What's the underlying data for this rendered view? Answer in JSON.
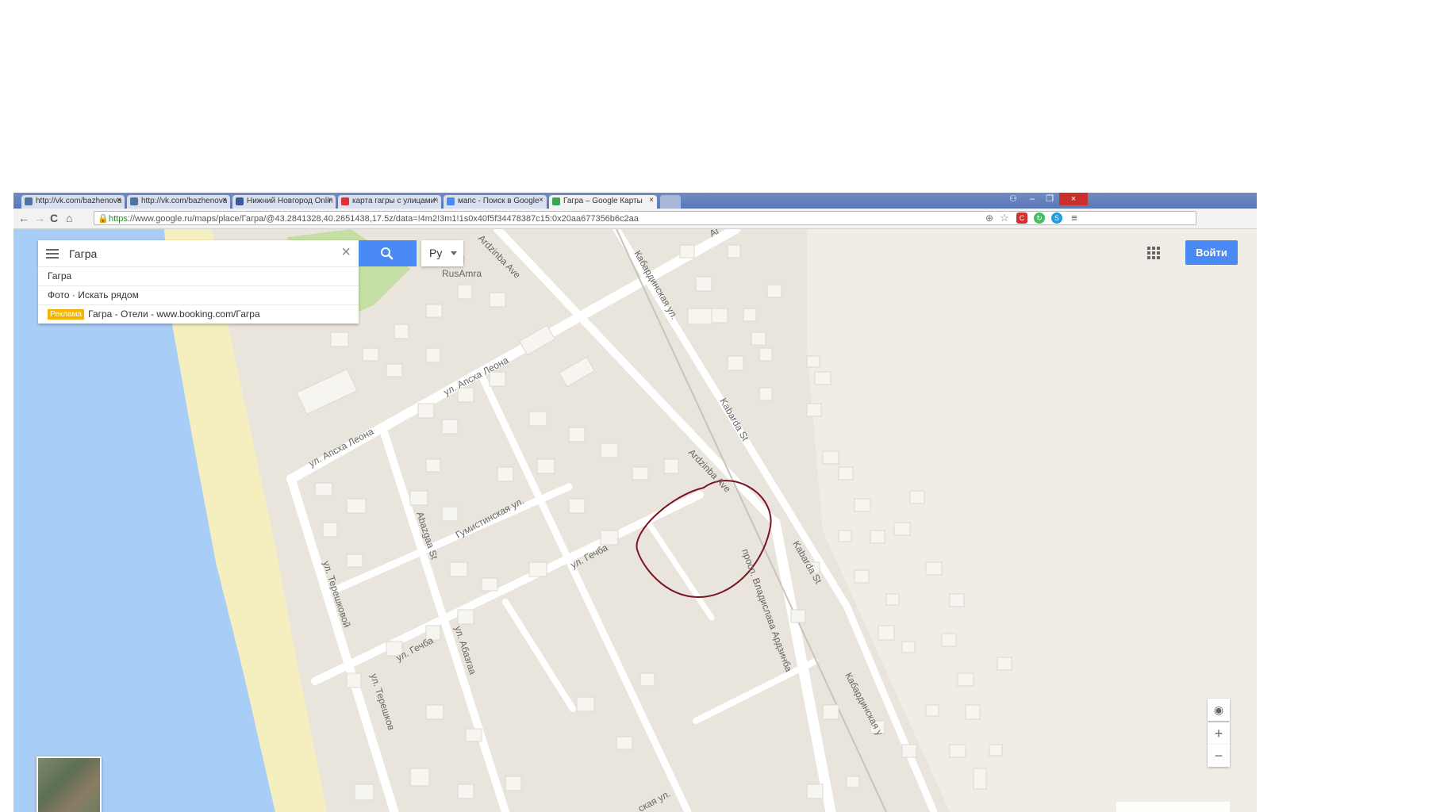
{
  "browser": {
    "tabs": [
      {
        "label": "http://vk.com/bazhenova",
        "favicon_color": "#4c75a3",
        "active": false
      },
      {
        "label": "http://vk.com/bazhenova",
        "favicon_color": "#4c75a3",
        "active": false
      },
      {
        "label": "Нижний Новгород Online",
        "favicon_color": "#3a5a9a",
        "active": false
      },
      {
        "label": "карта гагры с улицами и",
        "favicon_color": "#e03030",
        "active": false
      },
      {
        "label": "мапс - Поиск в Google",
        "favicon_color": "#4a8af4",
        "active": false
      },
      {
        "label": "Гагра – Google Карты",
        "favicon_color": "#34a853",
        "active": true
      }
    ],
    "tab_close": "×",
    "window_buttons": {
      "minimize": "–",
      "restore": "❐",
      "close": "×"
    },
    "nav": {
      "back": "←",
      "forward": "→",
      "reload": "C",
      "home": "⌂"
    },
    "url_scheme": "https",
    "url_rest": "://www.google.ru/maps/place/Гагра/@43.2841328,40.2651438,17.5z/data=!4m2!3m1!1s0x40f5f34478387c15:0x20aa677356b6c2aa",
    "extensions": [
      {
        "icon": "zoom-icon",
        "color": "#888"
      },
      {
        "icon": "star-icon",
        "color": "#888"
      },
      {
        "icon": "lastpass-icon",
        "color": "#d32f2f"
      },
      {
        "icon": "sync-icon",
        "color": "#3fbf5f"
      },
      {
        "icon": "skype-icon",
        "color": "#1e9de0"
      },
      {
        "icon": "menu-icon",
        "color": "#555"
      }
    ]
  },
  "maps": {
    "search": {
      "value": "Гагра"
    },
    "lang": "Ру",
    "suggestions": [
      {
        "text": "Гагра"
      },
      {
        "text": "Фото · Искать рядом"
      },
      {
        "ad_label": "Реклама",
        "text": "Гагра - Отели - www.booking.com/Гагра"
      }
    ],
    "signin_label": "Войти",
    "poi_label": "RusAmra",
    "zoom_in": "+",
    "zoom_out": "−",
    "streets": [
      {
        "name": "ул. Апсха Леона",
        "key": "apsha1"
      },
      {
        "name": "ул. Апсха Леона",
        "key": "apsha2"
      },
      {
        "name": "Ardzinba Ave",
        "key": "ard1"
      },
      {
        "name": "Ardzinba Ave",
        "key": "ard2"
      },
      {
        "name": "Кабардинская ул.",
        "key": "kab1"
      },
      {
        "name": "Kabarda St",
        "key": "kab2"
      },
      {
        "name": "Kabarda St",
        "key": "kab3"
      },
      {
        "name": "Кабардинская у",
        "key": "kab4"
      },
      {
        "name": "Гумистинская ул.",
        "key": "gum"
      },
      {
        "name": "Abazgaa St",
        "key": "abazgaa"
      },
      {
        "name": "ул. Абазгаа",
        "key": "abazgaa2"
      },
      {
        "name": "ул. Гечба",
        "key": "gechba1"
      },
      {
        "name": "ул. Гечба",
        "key": "gechba2"
      },
      {
        "name": "ул. Терешковой",
        "key": "ter1"
      },
      {
        "name": "ул. Терешков",
        "key": "ter2"
      },
      {
        "name": "просп. Владислава Ардзинба",
        "key": "prosp"
      },
      {
        "name": "ская ул.",
        "key": "bottom"
      },
      {
        "name": "Аг",
        "key": "top"
      }
    ],
    "colors": {
      "water": "#a8cdf6",
      "beach": "#f5efc0",
      "land": "#e9e5dc",
      "road": "#ffffff",
      "park": "#c5dea4",
      "annotation": "#7a1424",
      "accent": "#4a8af4"
    }
  }
}
